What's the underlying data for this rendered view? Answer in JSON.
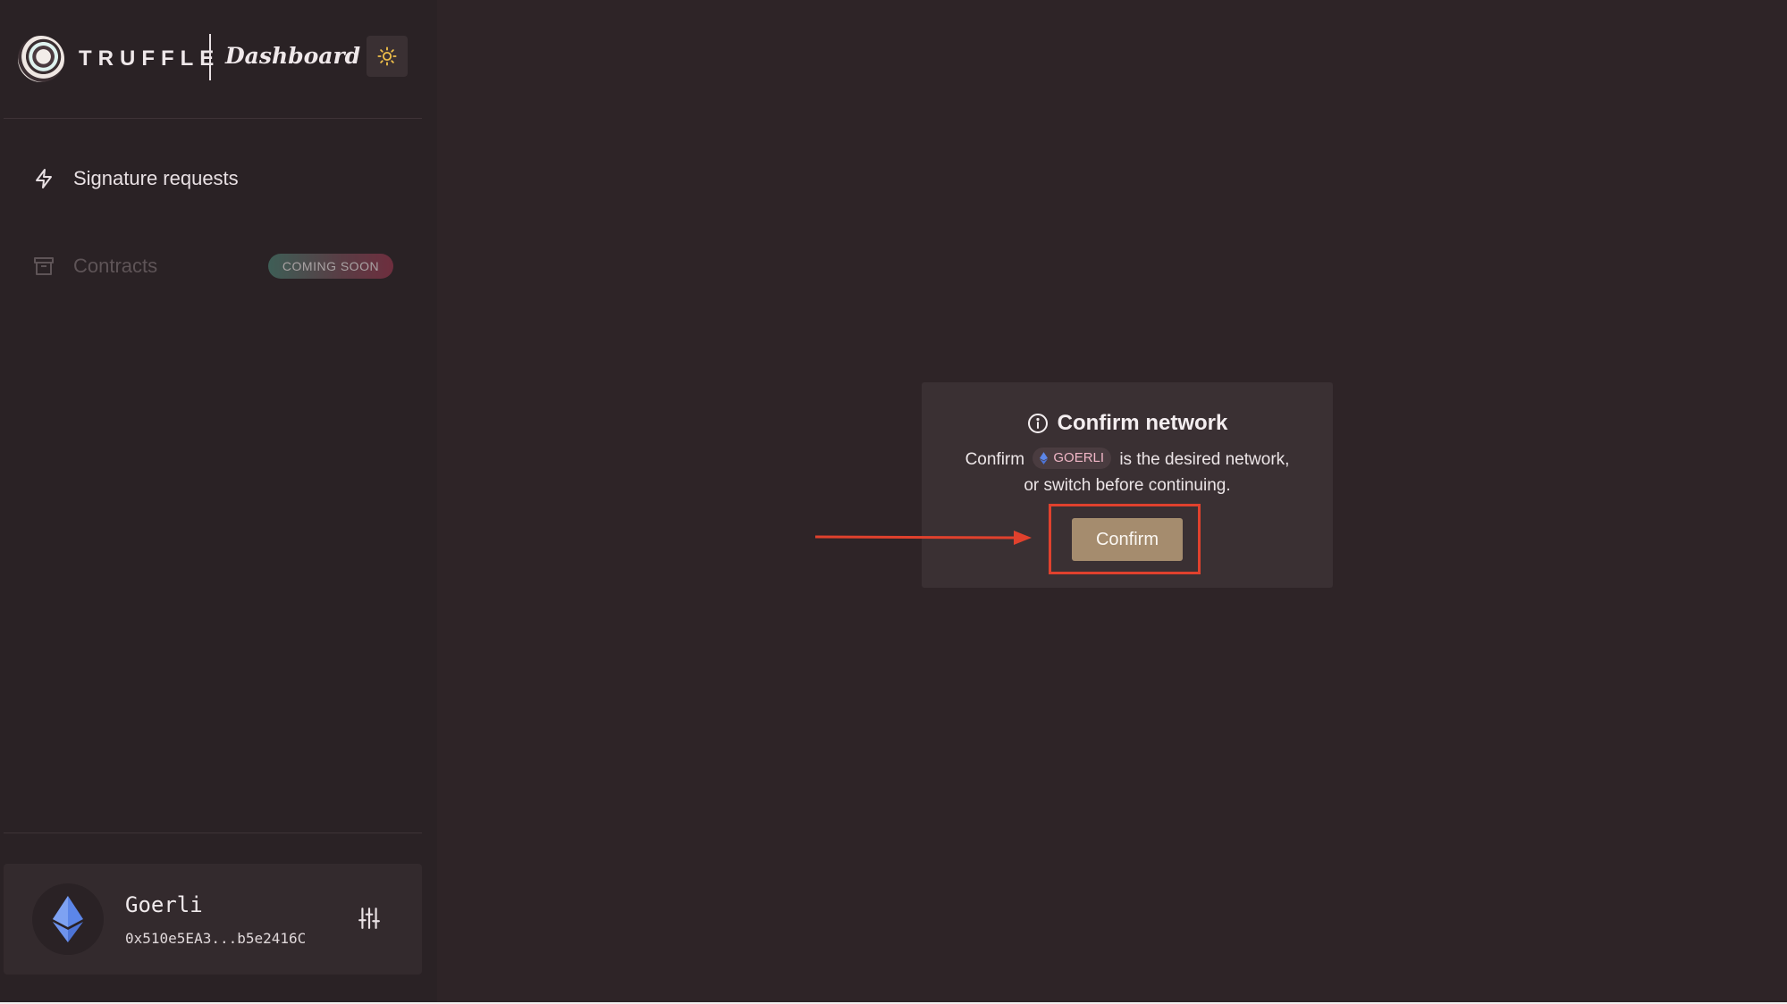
{
  "brand": {
    "wordmark": "TRUFFLE",
    "product": "Dashboard"
  },
  "header": {
    "theme_toggle_icon": "sun-icon"
  },
  "sidebar": {
    "items": [
      {
        "label": "Signature requests",
        "icon": "lightning-icon",
        "enabled": true
      },
      {
        "label": "Contracts",
        "icon": "archive-box-icon",
        "enabled": false,
        "badge": "COMING SOON"
      }
    ]
  },
  "network": {
    "name": "Goerli",
    "address": "0x510e5EA3...b5e2416C",
    "icon": "ethereum-icon",
    "settings_icon": "sliders-icon"
  },
  "modal": {
    "title": "Confirm network",
    "body_prefix": "Confirm",
    "network_chip": "GOERLI",
    "body_suffix_line1": "is the desired network,",
    "body_line2": "or switch before continuing.",
    "confirm_label": "Confirm"
  },
  "colors": {
    "background": "#2e2427",
    "sidebar": "#2a2225",
    "modal": "#3a3033",
    "confirm_button": "#a58c6e",
    "annotation": "#e0412d",
    "sun": "#f0c04a",
    "ethereum": "#5c86e8"
  }
}
